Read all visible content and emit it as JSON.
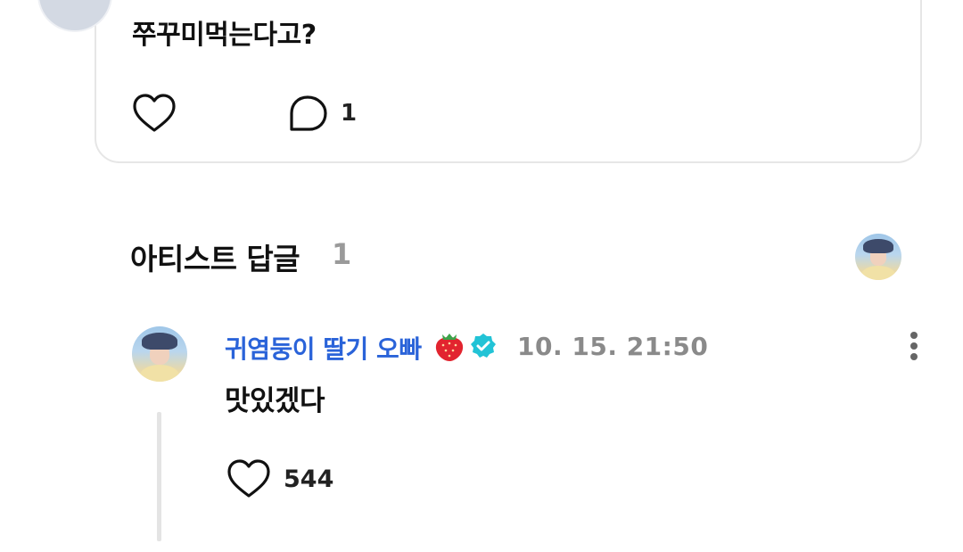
{
  "post": {
    "text": "쭈꾸미먹는다고?",
    "comment_count": "1",
    "icons": {
      "like": "heart-outline-icon",
      "comment": "speech-bubble-icon"
    }
  },
  "artist_replies": {
    "title": "아티스트 답글",
    "count": "1",
    "reply": {
      "author": "귀염둥이 딸기 오빠",
      "author_emoji": "🍓",
      "time": "10. 15. 21:50",
      "text": "맛있겠다",
      "like_count": "544",
      "icons": {
        "verified": "verified-badge-icon",
        "more": "more-vertical-icon",
        "like": "heart-outline-icon"
      }
    }
  },
  "colors": {
    "author_name": "#2a63d9",
    "verified_badge": "#22c3d6",
    "muted_text": "#8a8a8a",
    "card_border": "#e6e6e6"
  }
}
